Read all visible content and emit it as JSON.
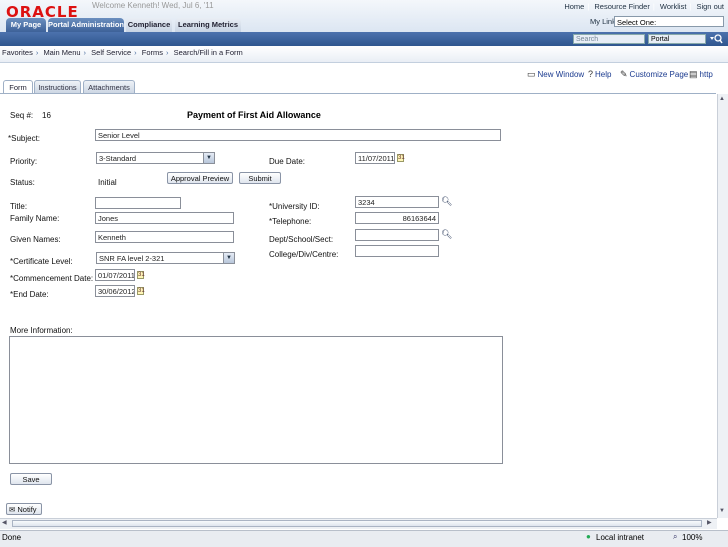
{
  "header": {
    "logo": "ORACLE",
    "welcome": "Welcome Kenneth!  Wed, Jul 6, '11",
    "links": [
      "Home",
      "Resource Finder",
      "Worklist",
      "Sign out"
    ],
    "mylinks_label": "My Links",
    "mylinks_value": "Select One:",
    "tabs": [
      "My Page",
      "Portal Administration",
      "Compliance",
      "Learning Metrics"
    ]
  },
  "searchbar": {
    "placeholder": "Search",
    "scope": "Portal",
    "go_icon": "magnifier-icon"
  },
  "breadcrumb": [
    "Favorites",
    "Main Menu",
    "Self Service",
    "Forms",
    "Search/Fill in a Form"
  ],
  "page_links": {
    "new_window": "New Window",
    "help": "Help",
    "customize": "Customize Page",
    "http": "http"
  },
  "page_tabs": [
    "Form",
    "Instructions",
    "Attachments"
  ],
  "form": {
    "seq_label": "Seq #:",
    "seq_value": "16",
    "title": "Payment of First Aid Allowance",
    "subject_label": "*Subject:",
    "subject_value": "Senior Level",
    "priority_label": "Priority:",
    "priority_value": "3-Standard",
    "due_label": "Due Date:",
    "due_value": "11/07/2011",
    "status_label": "Status:",
    "status_value": "Initial",
    "approval_btn": "Approval Preview",
    "submit_btn": "Submit",
    "title_label": "Title:",
    "title_value": "",
    "family_label": "Family Name:",
    "family_value": "Jones",
    "given_label": "Given Names:",
    "given_value": "Kenneth",
    "univ_label": "*University ID:",
    "univ_value": "3234",
    "tel_label": "*Telephone:",
    "tel_value": "86163644",
    "dept_label": "Dept/School/Sect:",
    "dept_value": "",
    "college_label": "College/Div/Centre:",
    "college_value": "",
    "cert_label": "*Certificate Level:",
    "cert_value": "SNR FA level 2-321",
    "commence_label": "*Commencement Date:",
    "commence_value": "01/07/2011",
    "end_label": "*End Date:",
    "end_value": "30/06/2012",
    "more_label": "More Information:",
    "more_value": "",
    "save_btn": "Save",
    "notify_btn": "Notify"
  },
  "statusbar": {
    "left": "Done",
    "zone": "Local intranet",
    "zoom": "100%"
  }
}
